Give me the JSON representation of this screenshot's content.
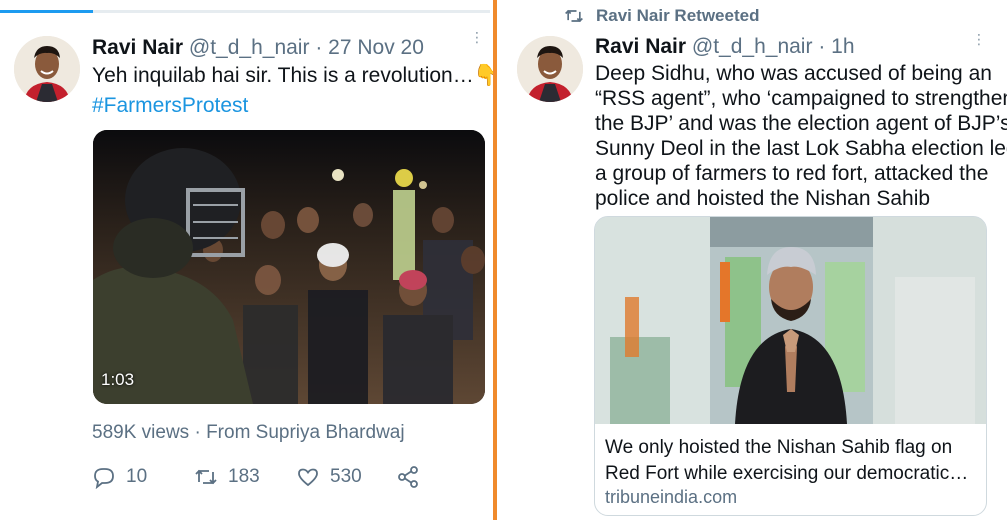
{
  "left_tweet": {
    "author_name": "Ravi Nair",
    "handle": "@t_d_h_nair",
    "separator": "·",
    "timestamp": "27 Nov 20",
    "text_line1": "Yeh inquilab hai sir. This is a revolution…",
    "hand_emoji": "👇",
    "hashtag": "#FarmersProtest",
    "video_duration": "1:03",
    "views": "589K views",
    "views_separator": "·",
    "from_text": "From Supriya Bhardwaj",
    "replies": "10",
    "retweets": "183",
    "likes": "530",
    "video_progress": 0.19
  },
  "right_tweet": {
    "retweeted_label": "Ravi Nair Retweeted",
    "author_name": "Ravi Nair",
    "handle": "@t_d_h_nair",
    "separator": "·",
    "timestamp": "1h",
    "text_lines": [
      "Deep Sidhu, who was accused of being an",
      "“RSS agent”, who ‘campaigned to strengthen",
      "the BJP’ and was the election agent of BJP’s",
      "Sunny Deol in the last Lok Sabha election led",
      "a group of farmers to red fort, attacked the",
      "police and hoisted the Nishan Sahib"
    ],
    "card_title_line1": "We only hoisted the Nishan Sahib flag on",
    "card_title_line2": "Red Fort while exercising our democratic…",
    "card_domain": "tribuneindia.com"
  },
  "colors": {
    "divider": "#f08a2c",
    "link": "#1b95e0",
    "muted": "#5b7083",
    "progress": "#1d9bf0"
  },
  "icons": [
    "reply-icon",
    "retweet-icon",
    "like-icon",
    "share-icon",
    "more-icon"
  ]
}
